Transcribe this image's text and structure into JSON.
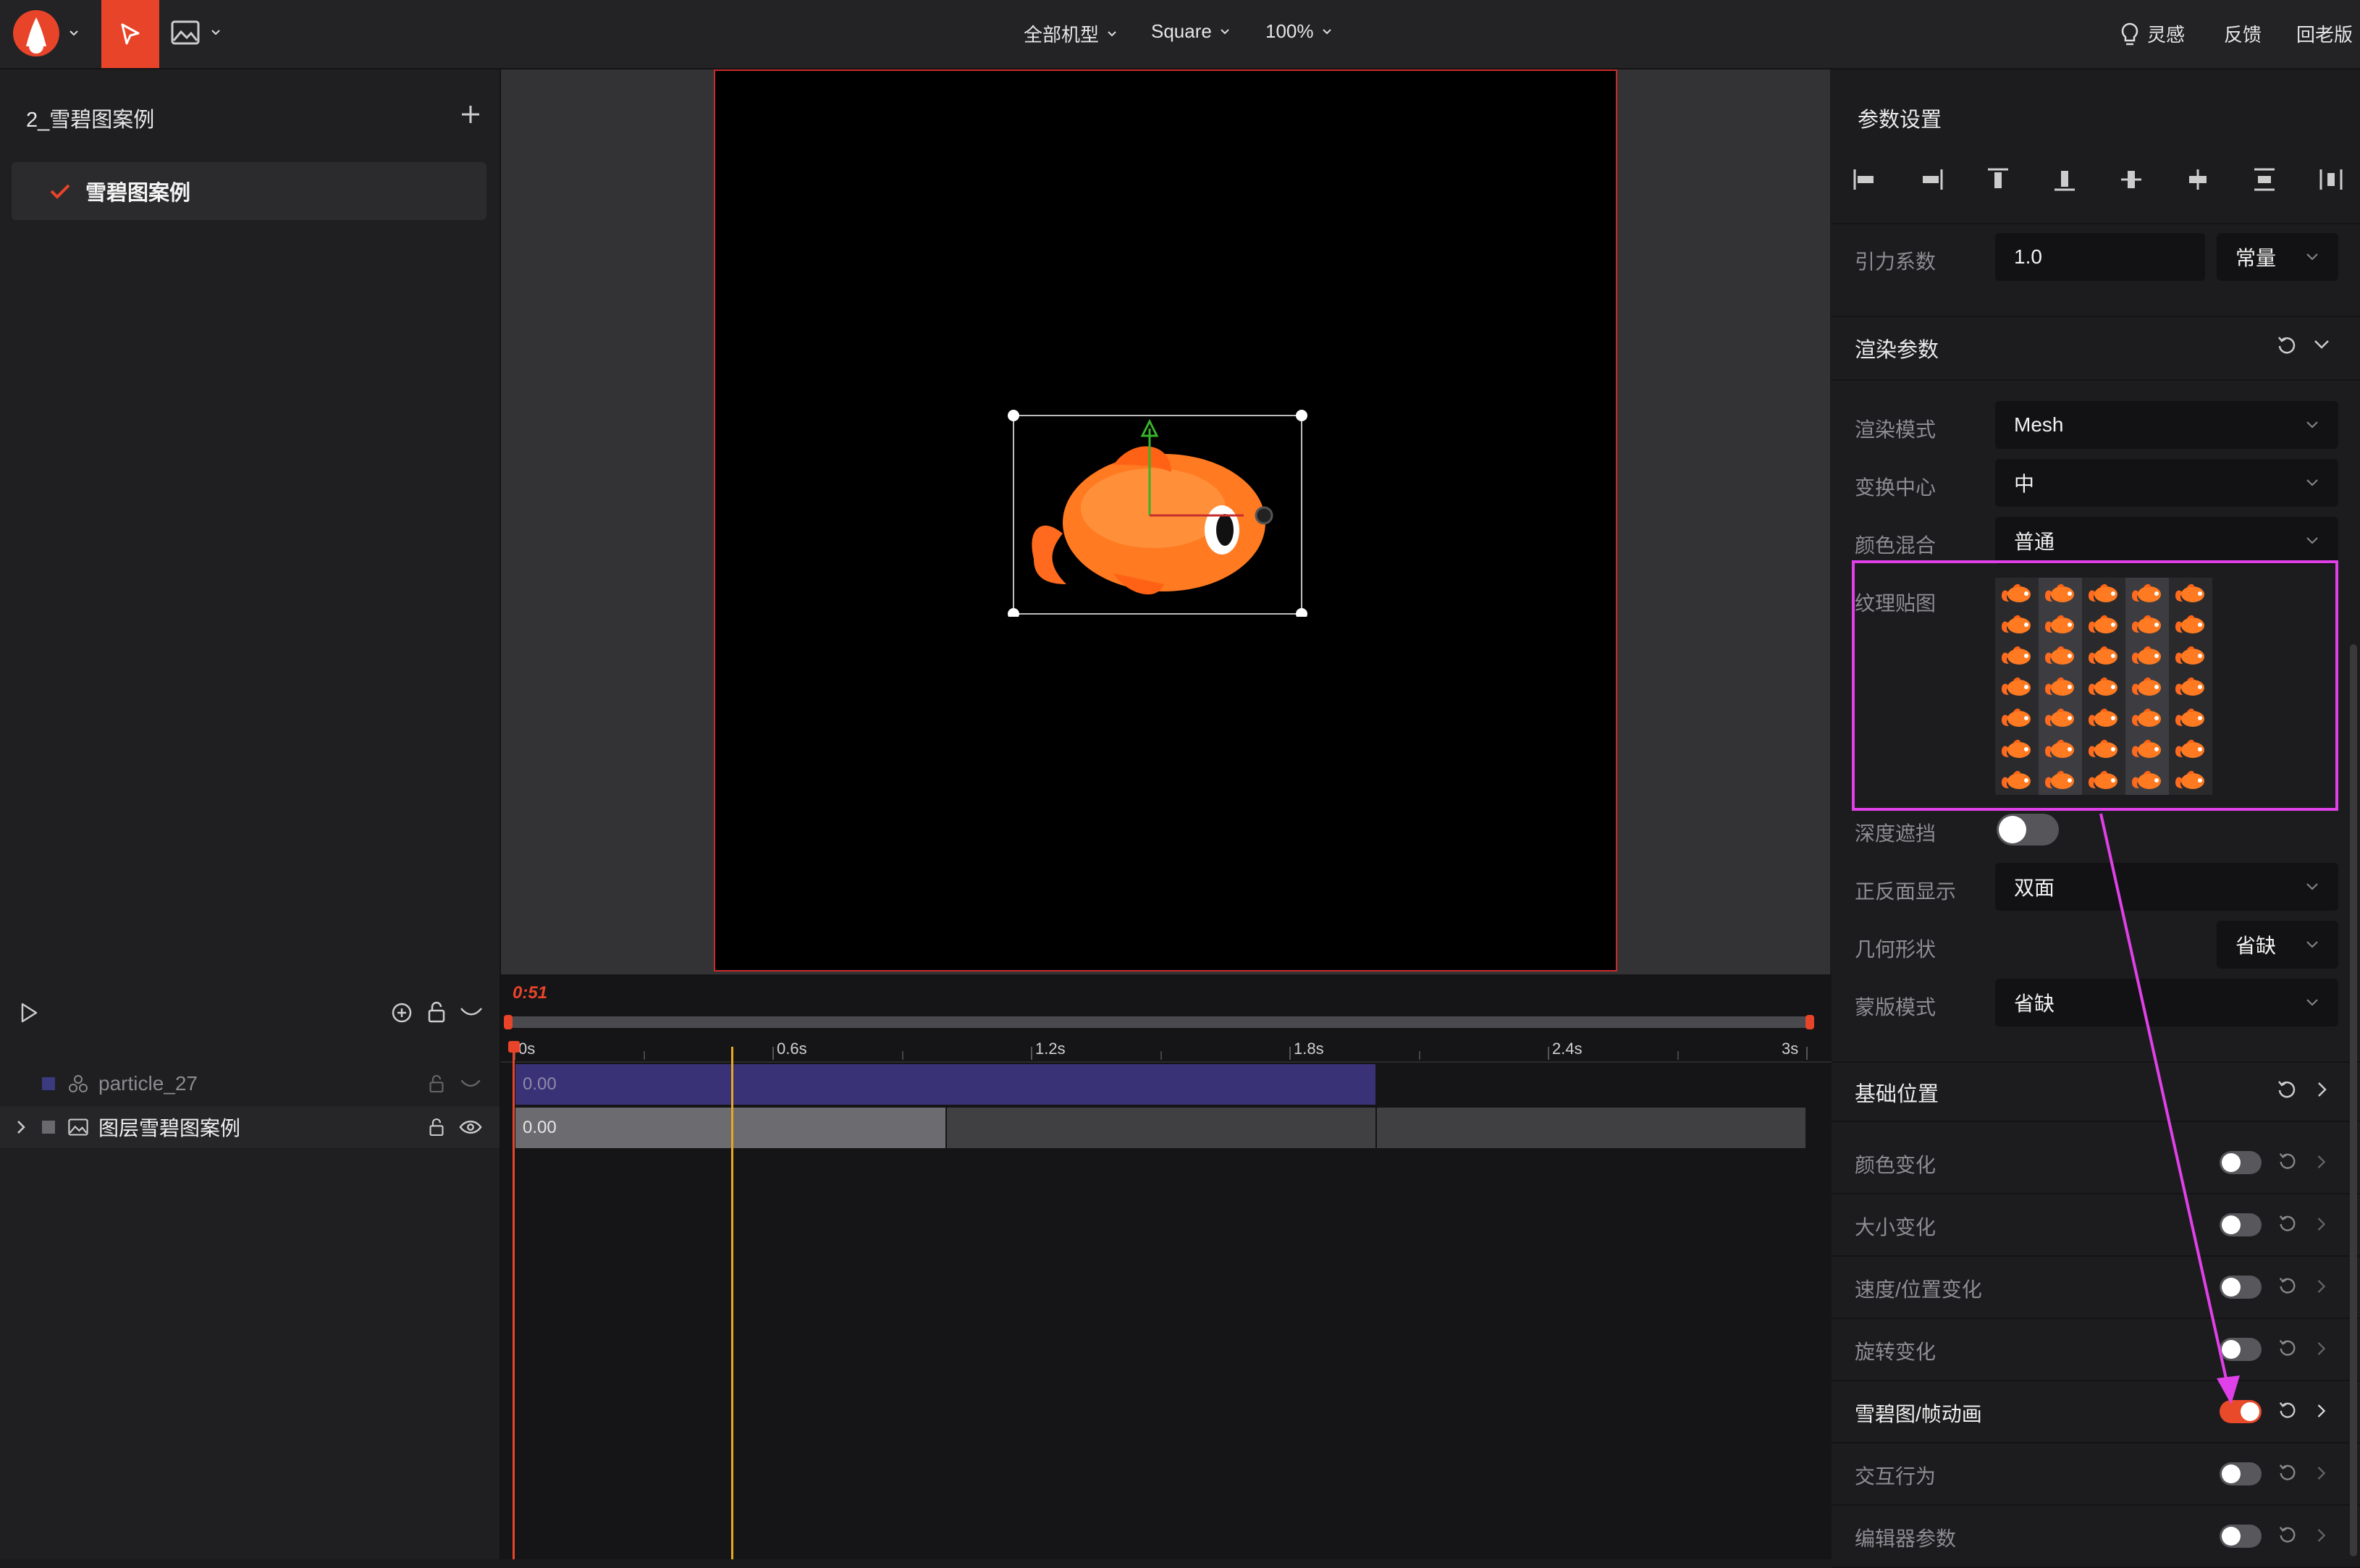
{
  "topbar": {
    "model_select": "全部机型",
    "ratio_select": "Square",
    "zoom_select": "100%",
    "inspiration": "灵感",
    "feedback": "反馈",
    "old_version": "回老版",
    "accent": "#e8442a"
  },
  "left_panel": {
    "project_title": "2_雪碧图案例",
    "items": [
      {
        "label": "雪碧图案例",
        "checked": true
      }
    ]
  },
  "timeline": {
    "current_time": "0:51",
    "ticks": [
      "0s",
      "0.6s",
      "1.2s",
      "1.8s",
      "2.4s",
      "3s"
    ],
    "layers": [
      {
        "name": "particle_27",
        "start": "0.00"
      },
      {
        "name": "图层雪碧图案例",
        "start": "0.00"
      }
    ]
  },
  "right_panel": {
    "title": "参数设置",
    "gravity_label": "引力系数",
    "gravity_value": "1.0",
    "gravity_mode": "常量",
    "render_section": "渲染参数",
    "render_mode_label": "渲染模式",
    "render_mode_value": "Mesh",
    "transform_center_label": "变换中心",
    "transform_center_value": "中",
    "color_blend_label": "颜色混合",
    "color_blend_value": "普通",
    "texture_label": "纹理贴图",
    "depth_label": "深度遮挡",
    "faces_label": "正反面显示",
    "faces_value": "双面",
    "geometry_label": "几何形状",
    "geometry_value": "省缺",
    "mask_label": "蒙版模式",
    "mask_value": "省缺",
    "basic_position": "基础位置",
    "modules": [
      {
        "label": "颜色变化",
        "on": false
      },
      {
        "label": "大小变化",
        "on": false
      },
      {
        "label": "速度/位置变化",
        "on": false
      },
      {
        "label": "旋转变化",
        "on": false
      },
      {
        "label": "雪碧图/帧动画",
        "on": true
      },
      {
        "label": "交互行为",
        "on": false
      },
      {
        "label": "编辑器参数",
        "on": false
      }
    ]
  },
  "annotation_color": "#e040e8"
}
